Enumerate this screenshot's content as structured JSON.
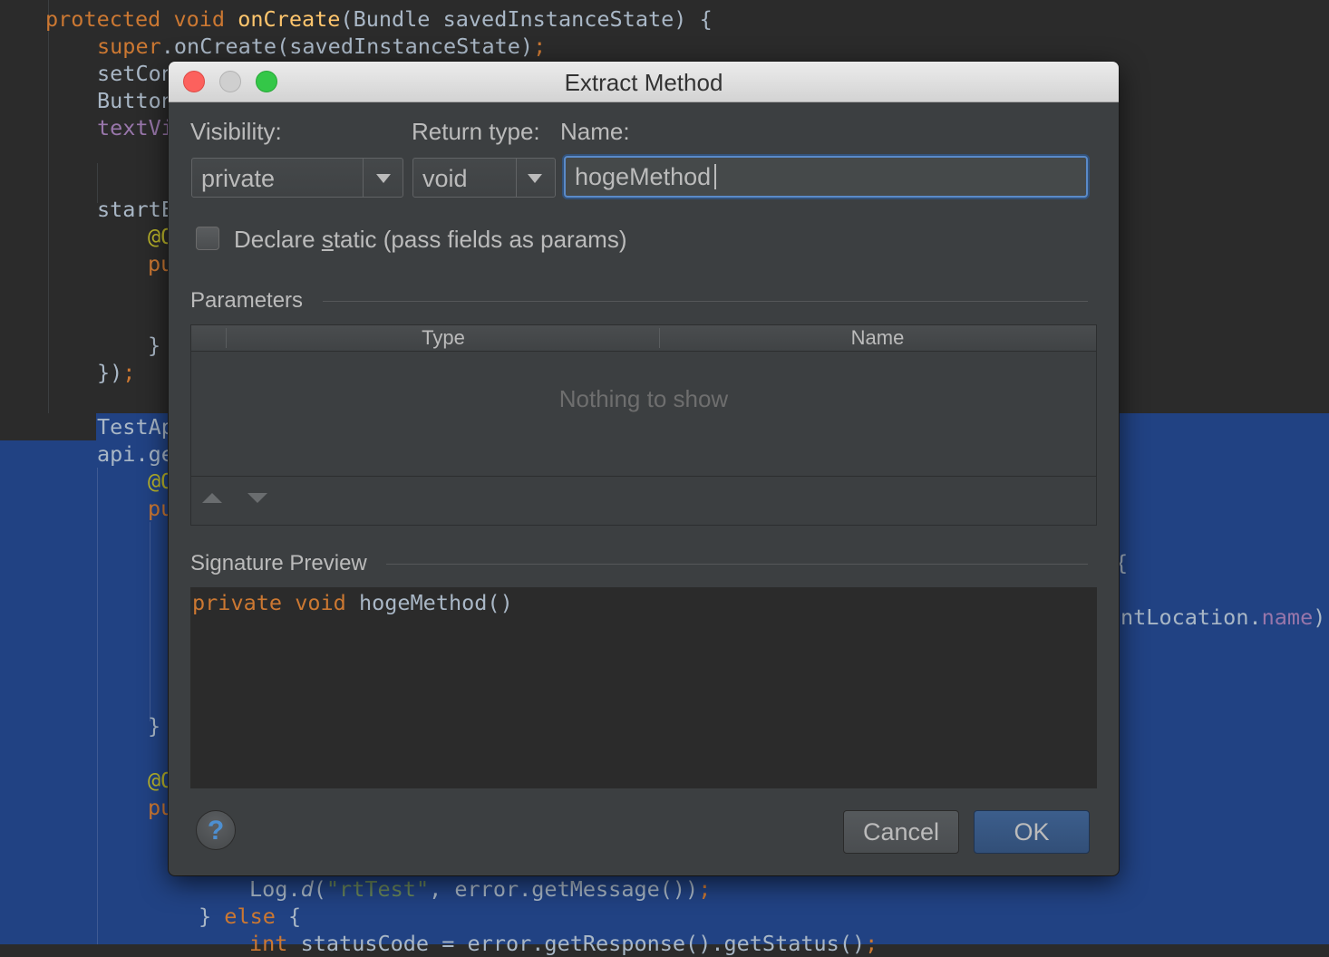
{
  "editor": {
    "lines": {
      "l0": {
        "kw": "protected void ",
        "fn": "onCreate",
        "rest": "(Bundle savedInstanceState) {"
      },
      "l1": {
        "kw": "super",
        "rest": ".onCreate(savedInstanceState)",
        "semi": ";"
      },
      "l2": "setCon",
      "l3": "Button",
      "l4": "textVi",
      "l5": "startE",
      "l6": "@O",
      "l7": "pu",
      "l8": "}",
      "l9": {
        "rest": "})",
        "semi": ";"
      },
      "l10": "TestAp",
      "l11": "api.ge",
      "l12": "@O",
      "l13": "pu",
      "l14": "{",
      "l15": {
        "rest": "ntLocation.",
        "fld": "name",
        "rest2": ")",
        "semi": ";"
      },
      "l16": "}",
      "l17": "@O",
      "l18": "pu",
      "l19": {
        "rest": "Log.",
        "it": "d",
        "rest2": "(",
        "str": "\"rtTest\"",
        "rest3": ", error.getMessage())",
        "semi": ";"
      },
      "l20": {
        "rest": "} ",
        "kw": "else",
        "rest2": " {"
      },
      "l21": {
        "kw": "int",
        "rest": " statusCode = error.getResponse().getStatus()",
        "semi": ";"
      }
    }
  },
  "dialog": {
    "title": "Extract Method",
    "visibility_label": "Visibility:",
    "visibility_value": "private",
    "return_type_label": "Return type:",
    "return_type_value": "void",
    "name_label": "Name:",
    "name_value": "hogeMethod",
    "declare_static": {
      "pre": "Declare ",
      "mnemonic": "s",
      "post": "tatic (pass fields as params)",
      "checked": false
    },
    "parameters_label": "Parameters",
    "table": {
      "columns": [
        "Type",
        "Name"
      ],
      "empty_text": "Nothing to show"
    },
    "signature_label": "Signature Preview",
    "signature": {
      "kw1": "private",
      "kw2": "void",
      "rest": " hogeMethod()"
    },
    "help_label": "?",
    "cancel_label": "Cancel",
    "ok_label": "OK"
  },
  "colors": {
    "accent": "#5a8ac8",
    "selection": "#214283",
    "keyword": "#cc7832",
    "method": "#ffc66d"
  }
}
